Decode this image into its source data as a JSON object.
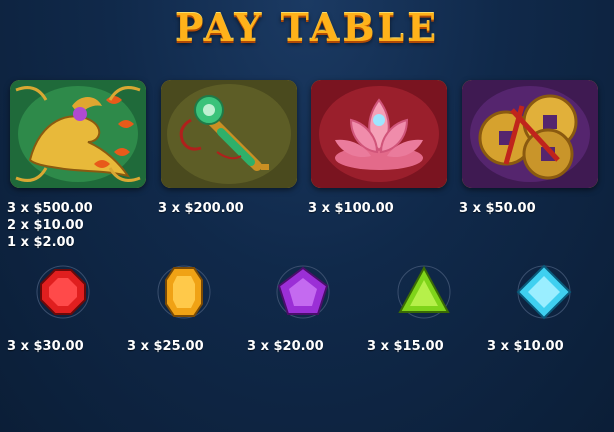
{
  "title": "PAY TABLE",
  "premium_symbols": [
    {
      "name": "phoenix-symbol-icon",
      "payouts": [
        "3 x $500.00",
        "2 x $10.00",
        "1 x $2.00"
      ]
    },
    {
      "name": "jade-ruyi-symbol-icon",
      "payouts": [
        "3 x $200.00"
      ]
    },
    {
      "name": "lotus-symbol-icon",
      "payouts": [
        "3 x $100.00"
      ]
    },
    {
      "name": "coins-symbol-icon",
      "payouts": [
        "3 x $50.00"
      ]
    }
  ],
  "gem_symbols": [
    {
      "name": "red-gem-icon",
      "color": "#e01f1f",
      "payout": "3 x $30.00"
    },
    {
      "name": "orange-gem-icon",
      "color": "#f0a215",
      "payout": "3 x $25.00"
    },
    {
      "name": "purple-gem-icon",
      "color": "#9b2fd6",
      "payout": "3 x $20.00"
    },
    {
      "name": "green-gem-icon",
      "color": "#7fd41a",
      "payout": "3 x $15.00"
    },
    {
      "name": "blue-gem-icon",
      "color": "#3fd0f0",
      "payout": "3 x $10.00"
    }
  ]
}
